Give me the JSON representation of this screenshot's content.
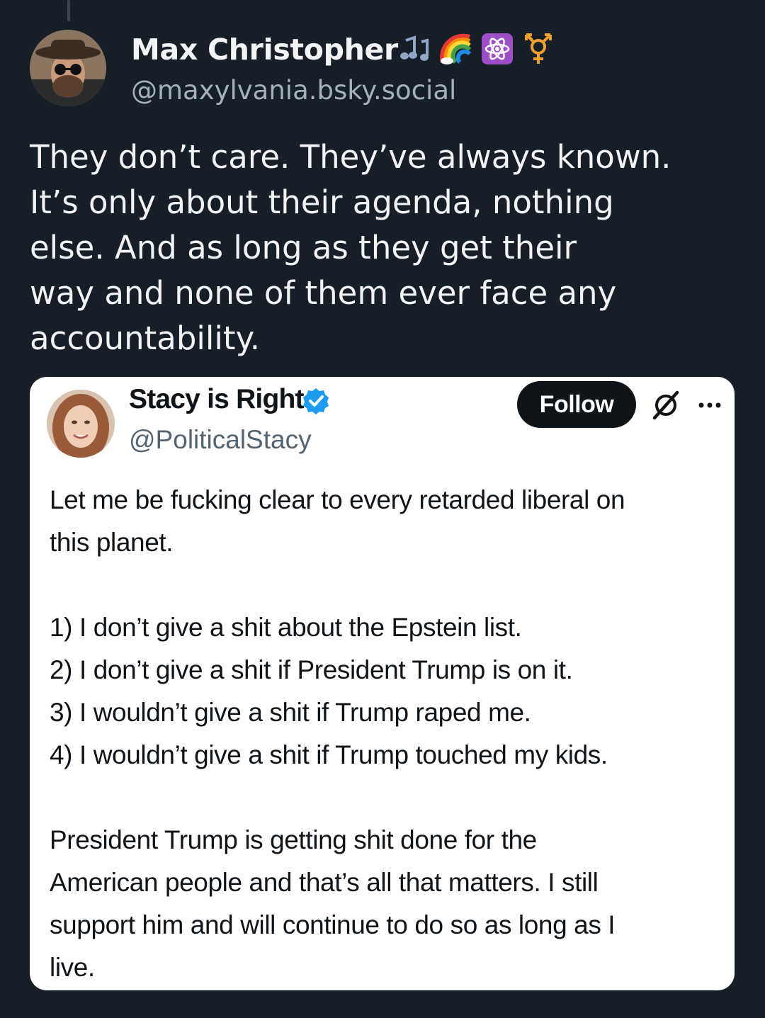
{
  "post": {
    "author_name": "Max Christopher",
    "handle": "@maxylvania.bsky.social",
    "name_emojis": [
      "music-notes-icon",
      "rainbow-icon",
      "atom-icon",
      "transgender-symbol-icon"
    ],
    "text_lines": [
      "They don’t care. They’ve always known.",
      "It’s only about their agenda, nothing",
      "else. And as long as they get their",
      "way and none of them ever face any",
      "accountability."
    ]
  },
  "quoted": {
    "author_name": "Stacy is Right",
    "handle": "@PoliticalStacy",
    "follow_label": "Follow",
    "paragraph1": [
      "Let me be fucking clear to every retarded liberal on",
      "this planet."
    ],
    "list": [
      "1) I don’t give a shit about the Epstein list.",
      "2) I don’t give a shit if President Trump is on it.",
      "3) I wouldn’t give a shit if Trump raped me.",
      "4) I wouldn’t give a shit if Trump touched my kids."
    ],
    "paragraph2": [
      "President Trump is getting shit done for the",
      "American people and that’s all that matters. I still",
      "support him and will continue to do so as long as I",
      "live."
    ]
  },
  "colors": {
    "background": "#161e27",
    "card": "#ffffff",
    "verified_badge": "#1d9bf0",
    "handle_gray": "#a5b0bd"
  }
}
